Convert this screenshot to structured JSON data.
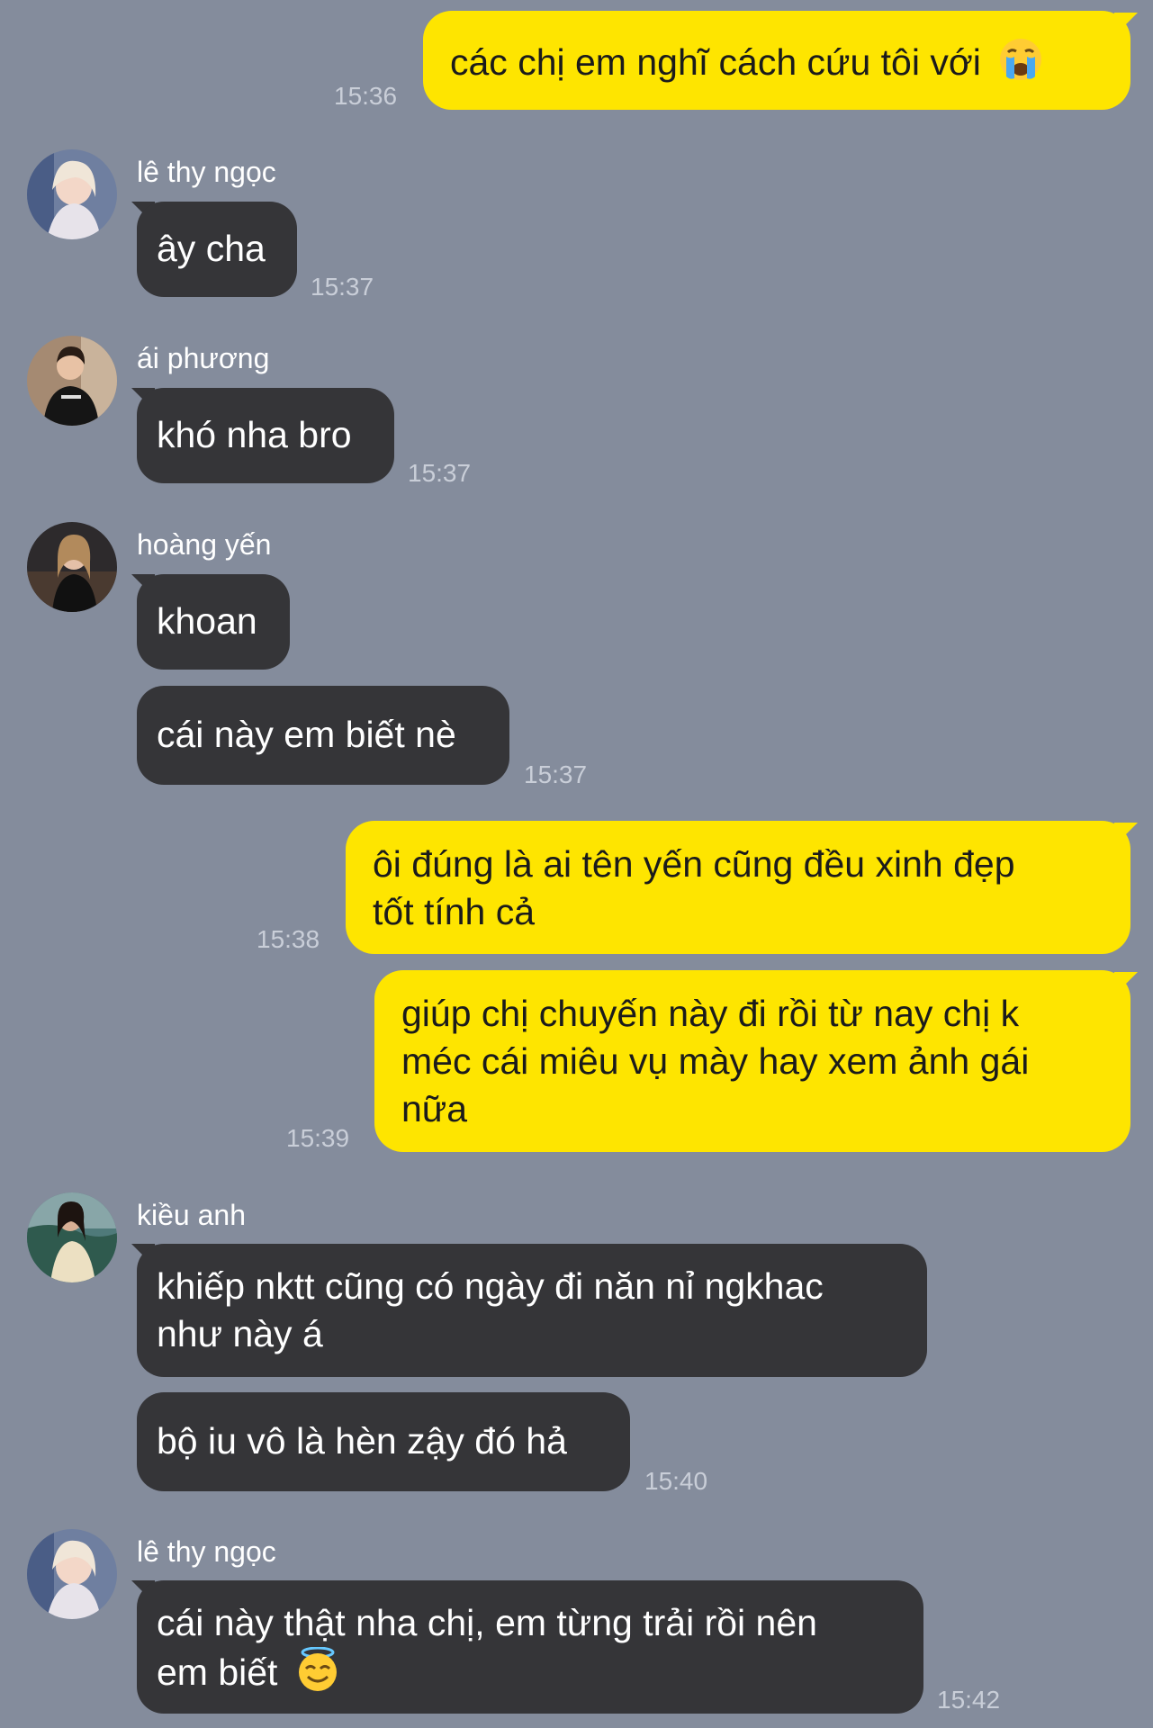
{
  "messages": {
    "m1": {
      "text": "các chị em nghĩ cách cứu tôi với",
      "emoji": "crying-face-icon",
      "time": "15:36"
    },
    "g1": {
      "sender": "lê thy ngọc",
      "text": "ây cha",
      "time": "15:37"
    },
    "g2": {
      "sender": "ái phương",
      "text": "khó nha bro",
      "time": "15:37"
    },
    "g3": {
      "sender": "hoàng yến",
      "text1": "khoan",
      "text2": "cái này em biết nè",
      "time": "15:37"
    },
    "m2": {
      "line1": "ôi đúng là ai tên yến cũng đều xinh đẹp",
      "line2": "tốt tính cả",
      "time": "15:38"
    },
    "m3": {
      "line1": "giúp chị chuyến này đi rồi từ nay chị k",
      "line2": "méc cái miêu vụ mày hay xem ảnh gái",
      "line3": "nữa",
      "time": "15:39"
    },
    "g4": {
      "sender": "kiều anh",
      "line1": "khiếp nktt cũng có ngày đi năn nỉ ngkhac",
      "line2": "như này á",
      "text2": "bộ iu vô là hèn zậy đó hả",
      "time": "15:40"
    },
    "g5": {
      "sender": "lê thy ngọc",
      "line1": "cái này thật nha chị, em từng trải rồi nên",
      "line2": "em biết",
      "emoji": "smiling-face-with-halo-icon",
      "time": "15:42"
    }
  },
  "colors": {
    "background": "#848c9c",
    "outgoing_bubble": "#fee500",
    "incoming_bubble": "#353538",
    "timestamp": "#c9ced8"
  }
}
